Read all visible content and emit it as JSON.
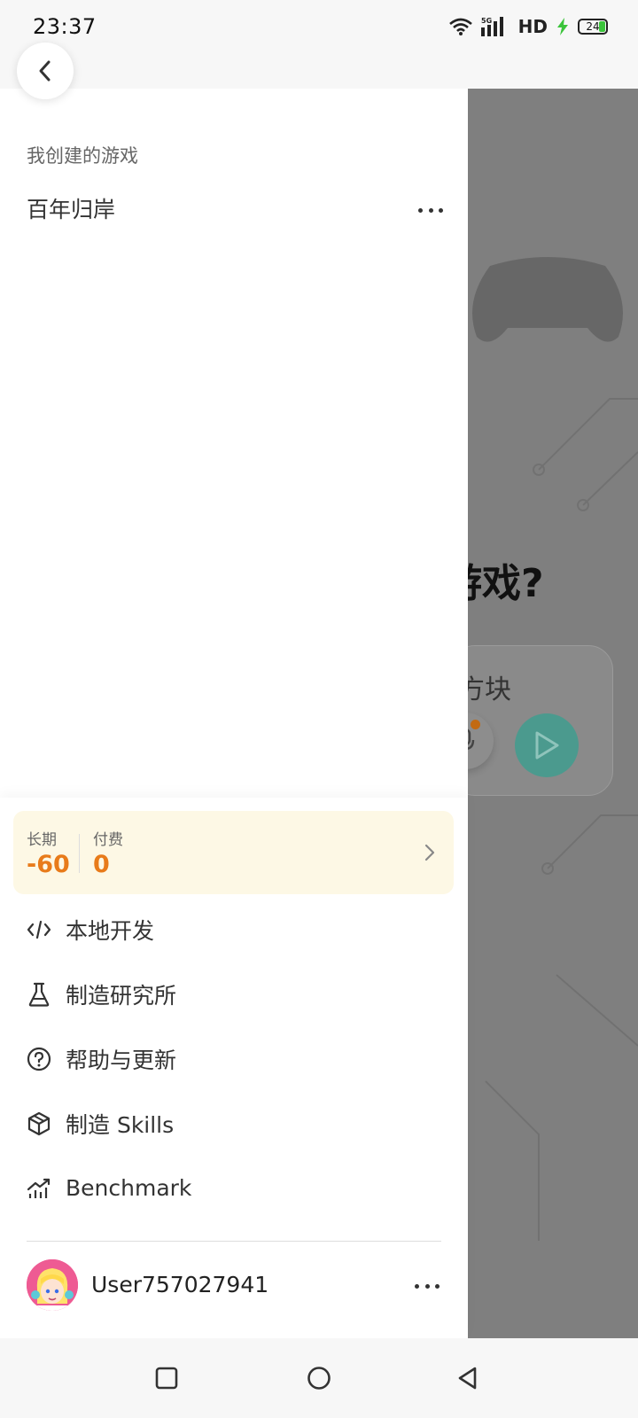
{
  "status_bar": {
    "time": "23:37",
    "network": "5G",
    "hd": "HD",
    "battery": "24",
    "icons": [
      "wifi-icon",
      "signal-icon",
      "charging-icon",
      "battery-icon"
    ]
  },
  "drawer": {
    "section_title": "我创建的游戏",
    "games": [
      {
        "title": "百年归岸"
      }
    ],
    "credits": {
      "long_term_label": "长期",
      "long_term_value": "-60",
      "paid_label": "付费",
      "paid_value": "0"
    },
    "menu": [
      {
        "label": "本地开发",
        "icon": "code-icon"
      },
      {
        "label": "制造研究所",
        "icon": "flask-icon"
      },
      {
        "label": "帮助与更新",
        "icon": "help-circle-icon"
      },
      {
        "label": "制造 Skills",
        "icon": "cube-icon"
      },
      {
        "label": "Benchmark",
        "icon": "chart-icon"
      }
    ],
    "user": {
      "name": "User757027941"
    }
  },
  "background_page": {
    "heading_fragment": "游戏?",
    "input_fragment": "方块"
  },
  "colors": {
    "accent_orange": "#e87b1a",
    "credits_bg": "#fdf8e5",
    "send_button": "#4b9a8e",
    "overlay": "#7f7f7f"
  }
}
